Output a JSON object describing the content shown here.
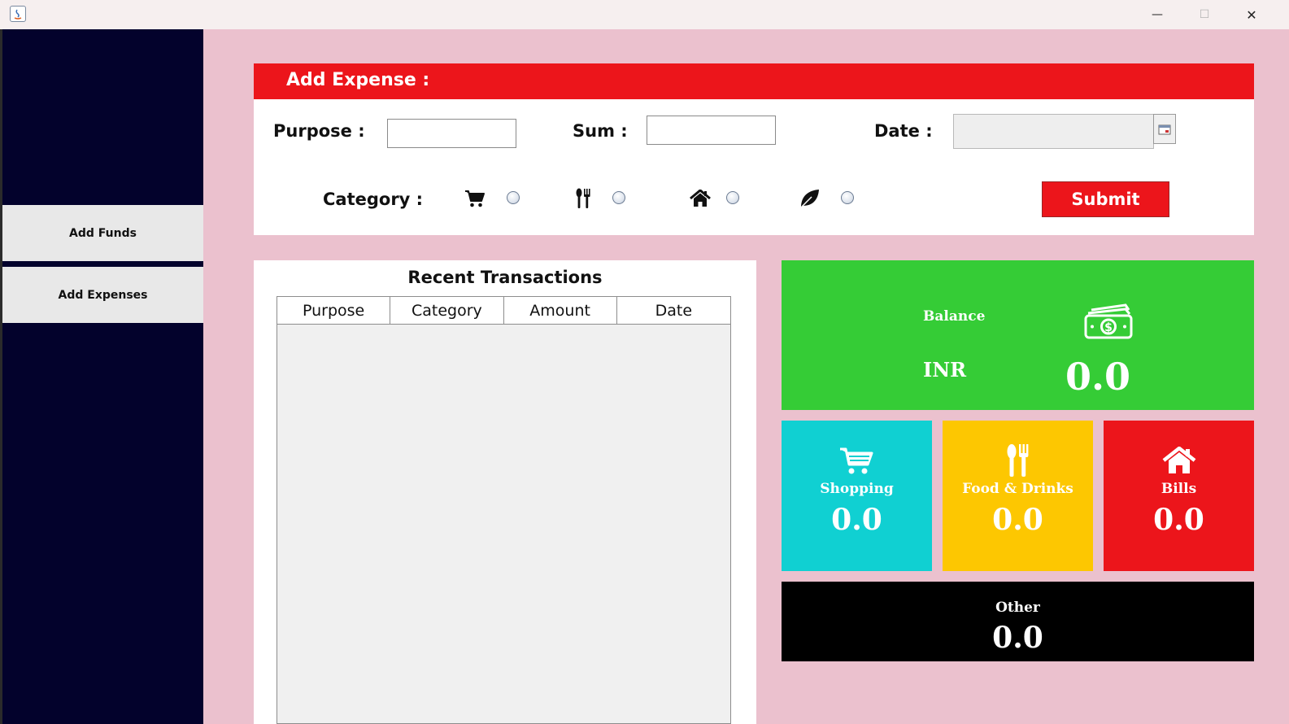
{
  "window": {
    "minimize_glyph": "—",
    "maximize_glyph": "☐",
    "close_glyph": "✕"
  },
  "sidebar": {
    "items": [
      {
        "label": "Add Funds"
      },
      {
        "label": "Add Expenses"
      }
    ]
  },
  "add_expense": {
    "title": "Add Expense  :",
    "purpose_label": "Purpose  :",
    "purpose_value": "",
    "sum_label": "Sum  :",
    "sum_value": "",
    "date_label": "Date  :",
    "date_value": "",
    "category_label": "Category  :",
    "category_options": [
      {
        "icon": "cart-icon",
        "selected": false
      },
      {
        "icon": "cutlery-icon",
        "selected": false
      },
      {
        "icon": "home-icon",
        "selected": false
      },
      {
        "icon": "leaf-icon",
        "selected": false
      }
    ],
    "submit_label": "Submit"
  },
  "transactions": {
    "title": "Recent Transactions",
    "columns": [
      "Purpose",
      "Category",
      "Amount",
      "Date"
    ],
    "rows": []
  },
  "balance": {
    "label": "Balance",
    "currency": "INR",
    "value": "0.0",
    "icon": "money-icon",
    "color": "#35cc36"
  },
  "categories": [
    {
      "name": "Shopping",
      "value": "0.0",
      "icon": "cart-icon",
      "color": "#10d0d2"
    },
    {
      "name": "Food & Drinks",
      "value": "0.0",
      "icon": "cutlery-icon",
      "color": "#fdc701"
    },
    {
      "name": "Bills",
      "value": "0.0",
      "icon": "home-icon",
      "color": "#ec151b"
    }
  ],
  "other": {
    "name": "Other",
    "value": "0.0",
    "color": "#000000"
  },
  "colors": {
    "sidebar": "#03022c",
    "background": "#ebc1ce",
    "accent": "#ec151b"
  }
}
